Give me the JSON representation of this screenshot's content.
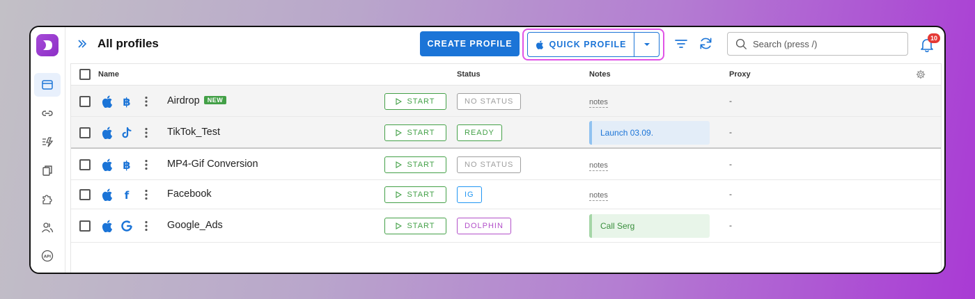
{
  "header": {
    "title": "All profiles",
    "create_label": "CREATE PROFILE",
    "quick_label": "QUICK PROFILE",
    "search_placeholder": "Search (press /)",
    "notifications_count": "10"
  },
  "sidebar": {
    "items": [
      {
        "icon": "browser-profiles-icon",
        "active": true
      },
      {
        "icon": "link-icon",
        "active": false
      },
      {
        "icon": "automation-icon",
        "active": false
      },
      {
        "icon": "clipboard-copy-icon",
        "active": false
      },
      {
        "icon": "puzzle-extension-icon",
        "active": false
      },
      {
        "icon": "users-icon",
        "active": false
      },
      {
        "icon": "api-icon",
        "active": false
      }
    ]
  },
  "table": {
    "columns": {
      "name": "Name",
      "status": "Status",
      "notes": "Notes",
      "proxy": "Proxy"
    },
    "rows": [
      {
        "os": "apple-icon",
        "site": "bitcoin-icon",
        "name": "Airdrop",
        "tag": "NEW",
        "start": "START",
        "status": "NO STATUS",
        "status_color": "#9e9e9e",
        "notes": "notes",
        "proxy": "-"
      },
      {
        "os": "apple-icon",
        "site": "tiktok-icon",
        "name": "TikTok_Test",
        "tag": "",
        "start": "START",
        "status": "READY",
        "status_color": "#43a047",
        "note_card": "Launch 03.09.",
        "note_bg": "#e3edf8",
        "note_fg": "#1b74d7",
        "note_bar": "#90c2f0",
        "proxy": "-"
      },
      {
        "os": "apple-icon",
        "site": "bitcoin-icon",
        "name": "MP4-Gif Conversion",
        "tag": "",
        "start": "START",
        "status": "NO STATUS",
        "status_color": "#9e9e9e",
        "notes": "notes",
        "proxy": "-"
      },
      {
        "os": "apple-icon",
        "site": "facebook-icon",
        "name": "Facebook",
        "tag": "",
        "start": "START",
        "status": "IG",
        "status_color": "#2196f3",
        "notes": "notes",
        "proxy": "-"
      },
      {
        "os": "apple-icon",
        "site": "google-icon",
        "name": "Google_Ads",
        "tag": "",
        "start": "START",
        "status": "DOLPHIN",
        "status_color": "#b24fc9",
        "note_card": "Call Serg",
        "note_bg": "#e8f5e9",
        "note_fg": "#388e3c",
        "note_bar": "#a5d6a7",
        "proxy": "-"
      }
    ]
  }
}
